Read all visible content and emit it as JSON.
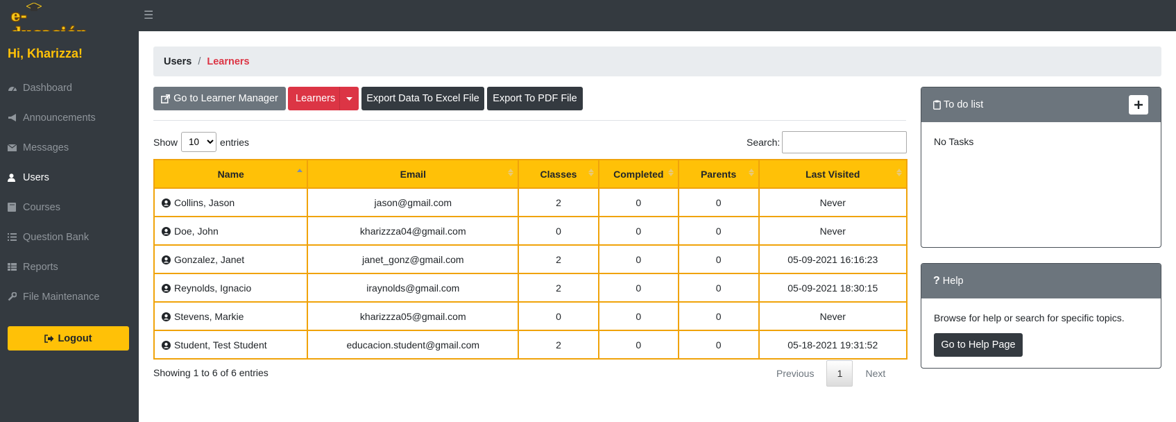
{
  "app": {
    "logo_text": "e-ducación"
  },
  "sidebar": {
    "greeting": "Hi, Kharizza!",
    "items": [
      {
        "label": "Dashboard",
        "icon": "dashboard-icon"
      },
      {
        "label": "Announcements",
        "icon": "bullhorn-icon"
      },
      {
        "label": "Messages",
        "icon": "envelope-icon"
      },
      {
        "label": "Users",
        "icon": "user-icon",
        "active": true
      },
      {
        "label": "Courses",
        "icon": "book-icon"
      },
      {
        "label": "Question Bank",
        "icon": "list-icon"
      },
      {
        "label": "Reports",
        "icon": "table-icon"
      },
      {
        "label": "File Maintenance",
        "icon": "wrench-icon"
      }
    ],
    "logout_label": "Logout"
  },
  "breadcrumb": {
    "parent": "Users",
    "separator": "/",
    "current": "Learners"
  },
  "toolbar": {
    "manager_label": "Go to Learner Manager",
    "learners_label": "Learners",
    "excel_label": "Export Data To Excel File",
    "pdf_label": "Export To PDF File"
  },
  "table_controls": {
    "show_label": "Show",
    "entries_value": "10",
    "entries_label": "entries",
    "search_label": "Search:"
  },
  "table": {
    "columns": [
      "Name",
      "Email",
      "Classes",
      "Completed",
      "Parents",
      "Last Visited"
    ],
    "rows": [
      {
        "name": "Collins, Jason",
        "email": "jason@gmail.com",
        "classes": "2",
        "completed": "0",
        "parents": "0",
        "last_visited": "Never"
      },
      {
        "name": "Doe, John",
        "email": "kharizzza04@gmail.com",
        "classes": "0",
        "completed": "0",
        "parents": "0",
        "last_visited": "Never"
      },
      {
        "name": "Gonzalez, Janet",
        "email": "janet_gonz@gmail.com",
        "classes": "2",
        "completed": "0",
        "parents": "0",
        "last_visited": "05-09-2021 16:16:23"
      },
      {
        "name": "Reynolds, Ignacio",
        "email": "iraynolds@gmail.com",
        "classes": "2",
        "completed": "0",
        "parents": "0",
        "last_visited": "05-09-2021 18:30:15"
      },
      {
        "name": "Stevens, Markie",
        "email": "kharizzza05@gmail.com",
        "classes": "0",
        "completed": "0",
        "parents": "0",
        "last_visited": "Never"
      },
      {
        "name": "Student, Test Student",
        "email": "educacion.student@gmail.com",
        "classes": "2",
        "completed": "0",
        "parents": "0",
        "last_visited": "05-18-2021 19:31:52"
      }
    ],
    "info": "Showing 1 to 6 of 6 entries",
    "pagination": {
      "previous": "Previous",
      "page": "1",
      "next": "Next"
    }
  },
  "todo": {
    "title": "To do list",
    "empty_text": "No Tasks"
  },
  "help": {
    "title": "Help",
    "text": "Browse for help or search for specific topics.",
    "button_label": "Go to Help Page"
  },
  "colors": {
    "accent": "#ffc107",
    "danger": "#dc3545",
    "dark": "#343a40",
    "secondary": "#6c757d"
  }
}
